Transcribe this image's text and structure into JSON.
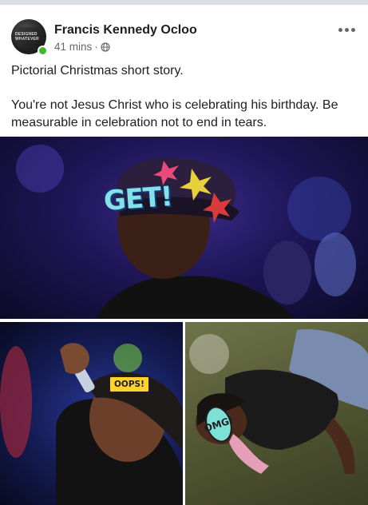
{
  "post": {
    "author": "Francis Kennedy Ocloo",
    "timestamp": "41 mins",
    "separator": "·",
    "privacy_icon": "globe-icon",
    "avatar_text": "DESIGNED WHATEVER",
    "text_paragraphs": [
      "Pictorial Christmas short story.",
      "You're not Jesus Christ who is celebrating his birthday. Be measurable in celebration not to end in tears."
    ]
  },
  "photos": {
    "main_sticker": "GET!",
    "left_sticker": "OOPS!",
    "right_sticker": "OMG!"
  },
  "colors": {
    "online": "#42b72a",
    "meta_text": "#65676b"
  }
}
